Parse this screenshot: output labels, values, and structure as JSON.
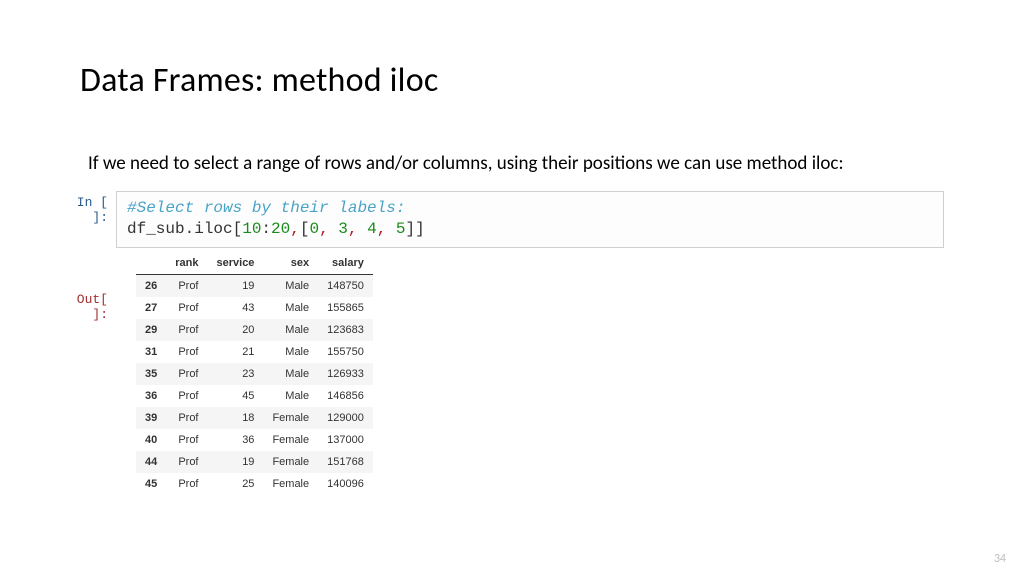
{
  "title": "Data Frames: method iloc",
  "body": "If we need to select a range of rows and/or columns, using their positions we can use method iloc:",
  "prompt_in": "In [ ]:",
  "prompt_out": "Out[ ]:",
  "code": {
    "comment": "#Select rows by their labels:",
    "call_prefix": "df_sub.iloc[",
    "n1": "10",
    "colon": ":",
    "n2": "20",
    "comma1": ",",
    "lbrack": "[",
    "a0": "0",
    "c1": ", ",
    "a1": "3",
    "c2": ", ",
    "a2": "4",
    "c3": ", ",
    "a3": "5",
    "rbrack": "]]"
  },
  "table": {
    "columns": [
      "rank",
      "service",
      "sex",
      "salary"
    ],
    "rows": [
      {
        "idx": "26",
        "rank": "Prof",
        "service": "19",
        "sex": "Male",
        "salary": "148750"
      },
      {
        "idx": "27",
        "rank": "Prof",
        "service": "43",
        "sex": "Male",
        "salary": "155865"
      },
      {
        "idx": "29",
        "rank": "Prof",
        "service": "20",
        "sex": "Male",
        "salary": "123683"
      },
      {
        "idx": "31",
        "rank": "Prof",
        "service": "21",
        "sex": "Male",
        "salary": "155750"
      },
      {
        "idx": "35",
        "rank": "Prof",
        "service": "23",
        "sex": "Male",
        "salary": "126933"
      },
      {
        "idx": "36",
        "rank": "Prof",
        "service": "45",
        "sex": "Male",
        "salary": "146856"
      },
      {
        "idx": "39",
        "rank": "Prof",
        "service": "18",
        "sex": "Female",
        "salary": "129000"
      },
      {
        "idx": "40",
        "rank": "Prof",
        "service": "36",
        "sex": "Female",
        "salary": "137000"
      },
      {
        "idx": "44",
        "rank": "Prof",
        "service": "19",
        "sex": "Female",
        "salary": "151768"
      },
      {
        "idx": "45",
        "rank": "Prof",
        "service": "25",
        "sex": "Female",
        "salary": "140096"
      }
    ]
  },
  "page_number": "34"
}
